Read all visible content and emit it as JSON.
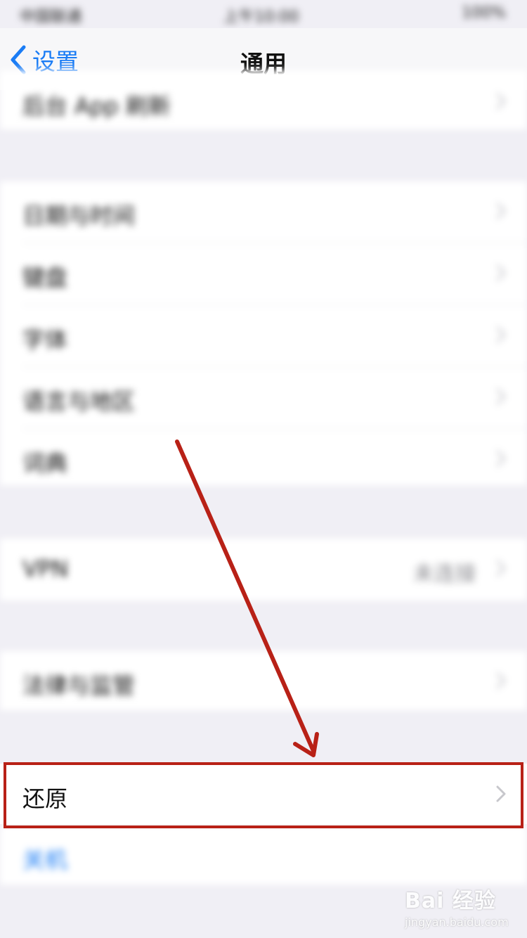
{
  "status_bar": {
    "carrier": "中国联通",
    "time": "上午10:00",
    "battery": "100%"
  },
  "nav": {
    "back_label": "设置",
    "title": "通用"
  },
  "groups": {
    "background_refresh": {
      "label": "后台 App 刷新"
    },
    "settings": [
      {
        "label": "日期与时间"
      },
      {
        "label": "键盘"
      },
      {
        "label": "字体"
      },
      {
        "label": "语言与地区"
      },
      {
        "label": "词典"
      }
    ],
    "vpn": {
      "label": "VPN",
      "value": "未连接"
    },
    "legal": {
      "label": "法律与监管"
    },
    "reset": {
      "label": "还原"
    },
    "shutdown": {
      "label": "关机"
    }
  },
  "watermark": {
    "logo": "Bai 经验",
    "url": "jingyan.baidu.com"
  },
  "colors": {
    "accent": "#1a7cf5",
    "highlight": "#b82117",
    "background": "#f0eff5"
  }
}
